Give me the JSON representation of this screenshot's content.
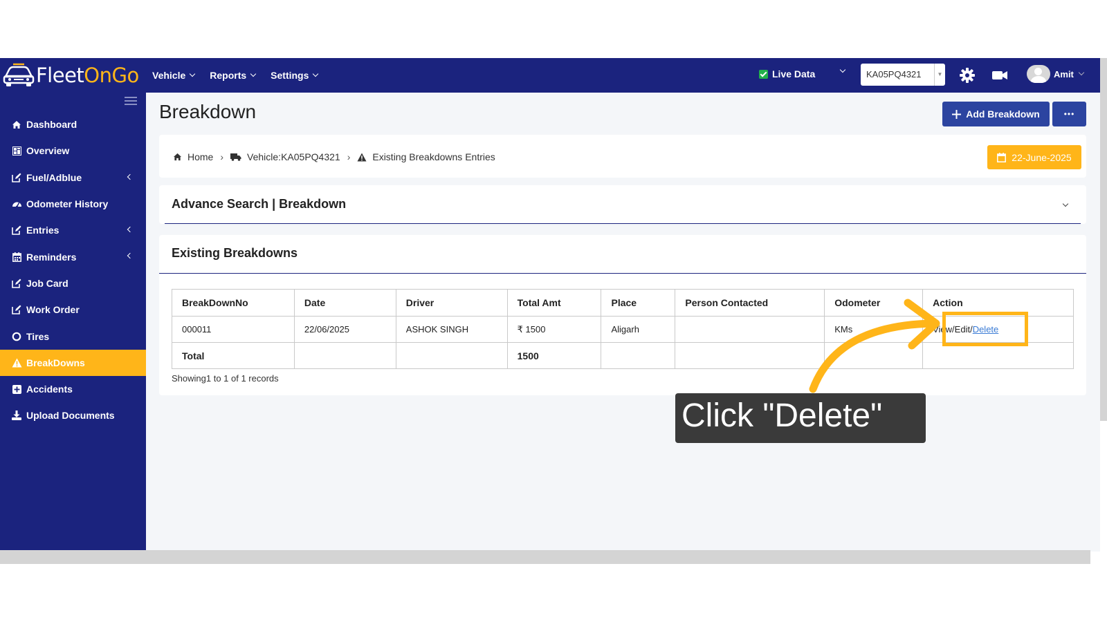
{
  "brand": {
    "name_part1": "Fleet",
    "name_part2": "On",
    "name_part3": "Go",
    "accent": "#ffb519",
    "primary": "#1b237e"
  },
  "topnav": {
    "menus": [
      {
        "label": "Vehicle"
      },
      {
        "label": "Reports"
      },
      {
        "label": "Settings"
      }
    ],
    "live_data_label": "Live Data",
    "live_data_checked": true,
    "vehicle_select": "KA05PQ4321",
    "user_name": "Amit"
  },
  "sidebar": {
    "items": [
      {
        "label": "Dashboard",
        "icon": "home-icon"
      },
      {
        "label": "Overview",
        "icon": "grid-icon"
      },
      {
        "label": "Fuel/Adblue",
        "icon": "edit-icon",
        "expandable": true
      },
      {
        "label": "Odometer History",
        "icon": "gauge-icon"
      },
      {
        "label": "Entries",
        "icon": "edit-icon",
        "expandable": true
      },
      {
        "label": "Reminders",
        "icon": "calendar-icon",
        "expandable": true
      },
      {
        "label": "Job Card",
        "icon": "edit-icon"
      },
      {
        "label": "Work Order",
        "icon": "edit-icon"
      },
      {
        "label": "Tires",
        "icon": "circle-icon"
      },
      {
        "label": "BreakDowns",
        "icon": "warning-icon",
        "active": true
      },
      {
        "label": "Accidents",
        "icon": "plus-square-icon"
      },
      {
        "label": "Upload Documents",
        "icon": "download-icon"
      }
    ]
  },
  "page": {
    "title": "Breakdown",
    "add_button": "Add Breakdown",
    "more_button": "•••",
    "breadcrumb": {
      "home": "Home",
      "vehicle": "Vehicle:KA05PQ4321",
      "current": "Existing Breakdowns Entries"
    },
    "date": "22-June-2025",
    "advance_search_title": "Advance Search | Breakdown",
    "existing_title": "Existing Breakdowns"
  },
  "table": {
    "headers": [
      "BreakDownNo",
      "Date",
      "Driver",
      "Total Amt",
      "Place",
      "Person Contacted",
      "Odometer",
      "Action"
    ],
    "rows": [
      {
        "no": "000011",
        "date": "22/06/2025",
        "driver": "ASHOK SINGH",
        "amount": "₹ 1500",
        "place": "Aligarh",
        "person": "",
        "odometer": "KMs",
        "view_edit": "View/Edit/",
        "delete": "Delete"
      }
    ],
    "total_label": "Total",
    "total_amount": "1500",
    "showing": "Showing1 to 1 of 1 records"
  },
  "overlay": {
    "instruction": "Click \"Delete\""
  }
}
